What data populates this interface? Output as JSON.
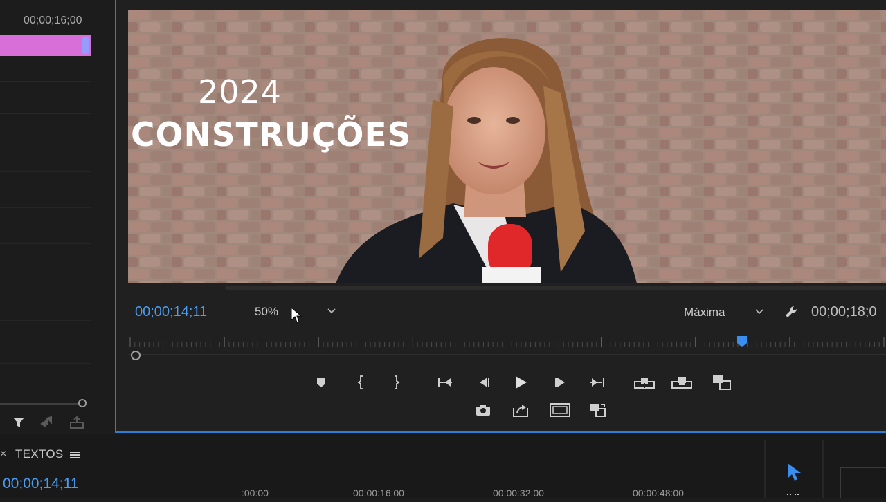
{
  "left_panel": {
    "timecode": "00;00;16;00",
    "clip_color": "#d86fd8"
  },
  "program_monitor": {
    "video": {
      "year_text": "2024",
      "headline_text": "CONSTRUÇÕES"
    },
    "current_timecode": "00;00;14;11",
    "zoom": "50%",
    "quality": "Máxima",
    "duration_timecode": "00;00;18;0",
    "playhead_fraction": 0.81
  },
  "sequence": {
    "tab_label": "TEXTOS",
    "close_glyph": "×",
    "current_timecode": "00;00;14;11",
    "ruler_ticks": [
      ":00:00",
      "00:00:16:00",
      "00:00:32:00",
      "00:00:48:00"
    ]
  },
  "colors": {
    "accent_blue": "#4a9cf0",
    "panel_border": "#2f7bd5"
  },
  "icons": {
    "monitor_row1": [
      "marker-icon",
      "mark-in-icon",
      "mark-out-icon",
      "go-to-in-icon",
      "step-back-icon",
      "play-icon",
      "step-forward-icon",
      "go-to-out-icon",
      "insert-icon",
      "overwrite-icon",
      "compare-icon"
    ],
    "monitor_row2": [
      "camera-icon",
      "export-frame-icon",
      "safe-margins-icon",
      "button-editor-icon"
    ]
  }
}
